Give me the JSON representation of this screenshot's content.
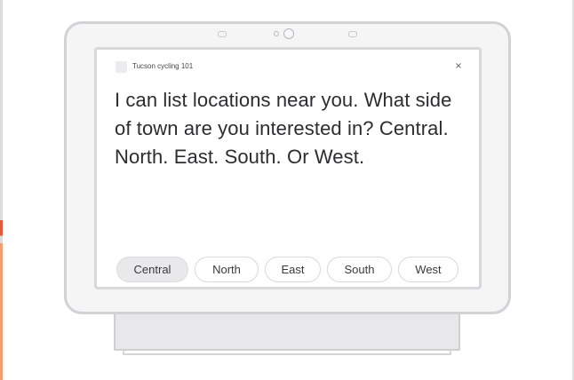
{
  "app": {
    "title": "Tucson cycling 101",
    "icon": "app-icon",
    "close_glyph": "×"
  },
  "response": {
    "text": "I can list locations near you. What side of town are you interested in? Central. North. East. South. Or West."
  },
  "suggestions": [
    {
      "label": "Central",
      "selected": true
    },
    {
      "label": "North",
      "selected": false
    },
    {
      "label": "East",
      "selected": false
    },
    {
      "label": "South",
      "selected": false
    },
    {
      "label": "West",
      "selected": false
    }
  ],
  "colors": {
    "frame": "#d2d2d5",
    "screen_background": "#ffffff",
    "text": "#2d2d2f",
    "chip_selected": "#e9e9eb"
  }
}
